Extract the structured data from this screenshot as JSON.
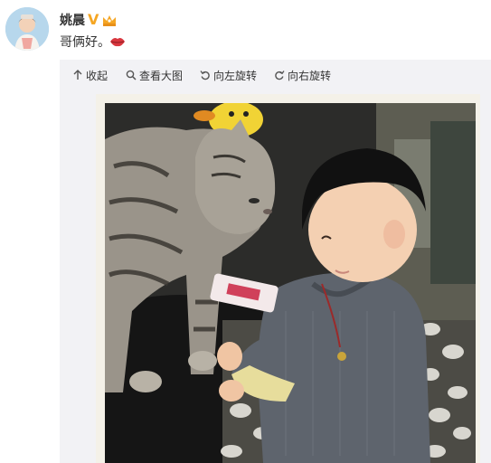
{
  "post": {
    "username": "姚晨",
    "verified_mark": "V",
    "text": "哥俩好。"
  },
  "toolbar": {
    "collapse_label": "收起",
    "view_large_label": "查看大图",
    "rotate_left_label": "向左旋转",
    "rotate_right_label": "向右旋转"
  },
  "icons": {
    "collapse": "arrow-up-icon",
    "view_large": "magnifier-icon",
    "rotate_left": "rotate-left-icon",
    "rotate_right": "rotate-right-icon",
    "verified": "verified-v-icon",
    "member": "crown-member-icon",
    "emoji": "lips-emoji-icon"
  },
  "colors": {
    "verified": "#f5a623",
    "text": "#333333",
    "card_background": "#f2f2f5"
  },
  "photo": {
    "subject": "photo of a tabby cat and a young boy"
  }
}
